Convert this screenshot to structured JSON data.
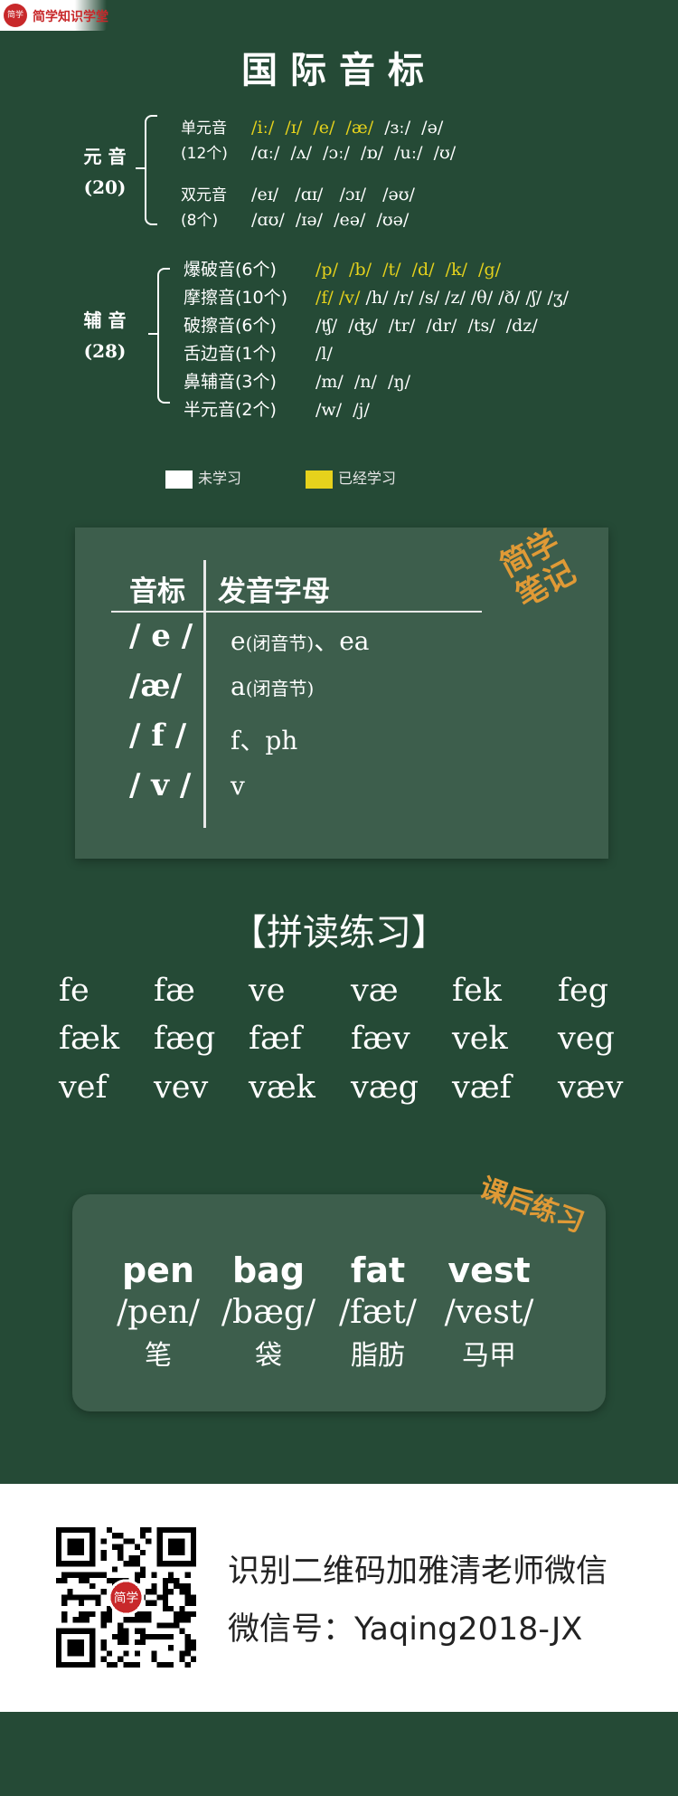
{
  "logo": {
    "mark": "简学",
    "text": "简学知识学堂"
  },
  "title": "国际音标",
  "vowels": {
    "label": "元 音",
    "count": "(20)",
    "mono_label": "单元音",
    "mono_count": "(12个)",
    "mono_row1_known": "/iː/  /ɪ/  /e/  /æ/",
    "mono_row1_rest": "  /ɜː/  /ə/",
    "mono_row2": "/ɑː/  /ʌ/  /ɔː/  /ɒ/  /uː/  /ʊ/",
    "di_label": "双元音",
    "di_count": "(8个)",
    "di_row1": "/eɪ/   /ɑɪ/   /ɔɪ/   /əʊ/",
    "di_row2": "/ɑʊ/  /ɪə/  /eə/  /ʊə/"
  },
  "consonants": {
    "label": "辅 音",
    "count": "(28)",
    "rows": [
      {
        "cat": "爆破音(6个)",
        "known": "/p/  /b/  /t/  /d/  /k/  /g/",
        "rest": ""
      },
      {
        "cat": "摩擦音(10个)",
        "known": "/f/ /v/",
        "rest": " /h/ /r/ /s/ /z/ /θ/ /ð/ /ʃ/ /ʒ/"
      },
      {
        "cat": "破擦音(6个)",
        "known": "",
        "rest": "/ʧ/  /ʤ/  /tr/  /dr/  /ts/  /dz/"
      },
      {
        "cat": "舌边音(1个)",
        "known": "",
        "rest": "/l/"
      },
      {
        "cat": "鼻辅音(3个)",
        "known": "",
        "rest": "/m/  /n/  /ŋ/"
      },
      {
        "cat": "半元音(2个)",
        "known": "",
        "rest": "/w/  /j/"
      }
    ]
  },
  "legend": {
    "unlearned": "未学习",
    "learned": "已经学习"
  },
  "colors": {
    "bg": "#254a36",
    "card": "#3d5e4c",
    "highlight": "#e6d21c",
    "stamp": "#e09a36"
  },
  "notes": {
    "stamp": "简学\n笔记",
    "header_symbol": "音标",
    "header_letters": "发音字母",
    "rows": [
      {
        "symbol": "/ e /",
        "letters": "e",
        "note": "(闭音节)",
        "extra": "、ea"
      },
      {
        "symbol": "/æ/",
        "letters": "a",
        "note": "(闭音节)",
        "extra": ""
      },
      {
        "symbol": "/ f /",
        "letters": "f、ph",
        "note": "",
        "extra": ""
      },
      {
        "symbol": "/ v /",
        "letters": "v",
        "note": "",
        "extra": ""
      }
    ]
  },
  "practice": {
    "title": "【拼读练习】",
    "rows": [
      [
        "fe",
        "fæ",
        "ve",
        "væ",
        "fek",
        "feg"
      ],
      [
        "fæk",
        "fæg",
        "fæf",
        "fæv",
        "vek",
        "veg"
      ],
      [
        "vef",
        "vev",
        "væk",
        "væg",
        "væf",
        "væv"
      ]
    ]
  },
  "homework": {
    "stamp": "课后练习",
    "words": [
      {
        "en": "pen",
        "ph": "/pen/",
        "cn": "笔"
      },
      {
        "en": "bag",
        "ph": "/bæg/",
        "cn": "袋"
      },
      {
        "en": "fat",
        "ph": "/fæt/",
        "cn": "脂肪"
      },
      {
        "en": "vest",
        "ph": "/vest/",
        "cn": "马甲"
      }
    ]
  },
  "footer": {
    "line1": "识别二维码加雅清老师微信",
    "line2": "微信号：Yaqing2018-JX",
    "qr_badge": "简学"
  }
}
